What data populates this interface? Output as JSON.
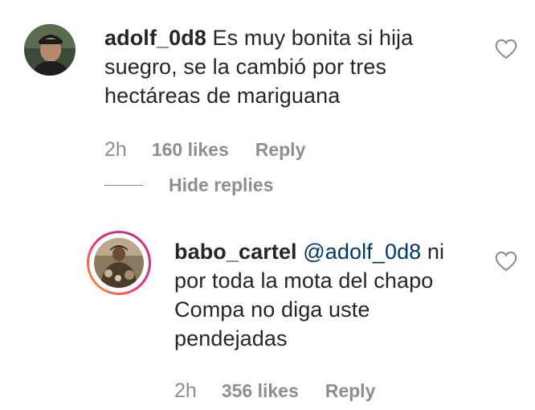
{
  "comment": {
    "username": "adolf_0d8",
    "text_line1": "Es muy bonita si hija",
    "text_line2": "suegro, se la cambió por tres",
    "text_line3": "hectáreas de mariguana",
    "time": "2h",
    "likes": "160 likes",
    "reply_label": "Reply",
    "avatar_icon": "avatar-photo-icon",
    "like_icon": "heart-outline-icon"
  },
  "hide_replies": {
    "label": "Hide replies"
  },
  "reply": {
    "username": "babo_cartel",
    "mention": "@adolf_0d8",
    "text_line1_suffix": "ni",
    "text_line2": "por toda la mota del chapo",
    "text_line3": "Compa no diga uste",
    "text_line4": "pendejadas",
    "time": "2h",
    "likes": "356 likes",
    "reply_label": "Reply",
    "avatar_icon": "avatar-photo-icon",
    "like_icon": "heart-outline-icon"
  },
  "colors": {
    "text": "#262626",
    "secondary": "#8e8e8e",
    "mention": "#00376b",
    "story_ring_start": "#f9a530",
    "story_ring_end": "#8a3ab9"
  }
}
